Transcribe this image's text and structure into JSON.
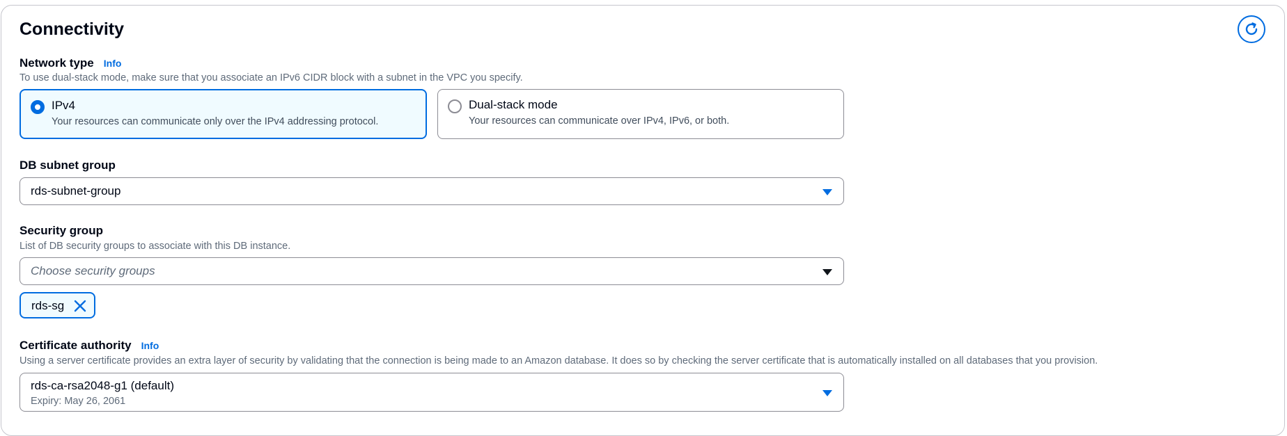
{
  "section": {
    "title": "Connectivity",
    "refresh_icon": "refresh-icon"
  },
  "network_type": {
    "label": "Network type",
    "info": "Info",
    "description": "To use dual-stack mode, make sure that you associate an IPv6 CIDR block with a subnet in the VPC you specify.",
    "options": [
      {
        "title": "IPv4",
        "description": "Your resources can communicate only over the IPv4 addressing protocol.",
        "selected": true
      },
      {
        "title": "Dual-stack mode",
        "description": "Your resources can communicate over IPv4, IPv6, or both.",
        "selected": false
      }
    ]
  },
  "db_subnet_group": {
    "label": "DB subnet group",
    "value": "rds-subnet-group"
  },
  "security_group": {
    "label": "Security group",
    "description": "List of DB security groups to associate with this DB instance.",
    "placeholder": "Choose security groups",
    "tokens": [
      "rds-sg"
    ]
  },
  "certificate_authority": {
    "label": "Certificate authority",
    "info": "Info",
    "description": "Using a server certificate provides an extra layer of security by validating that the connection is being made to an Amazon database. It does so by checking the server certificate that is automatically installed on all databases that you provision.",
    "value": "rds-ca-rsa2048-g1 (default)",
    "expiry": "Expiry: May 26, 2061"
  },
  "colors": {
    "accent": "#006ce0",
    "text": "#000716",
    "muted": "#5f6b7a",
    "border": "#8c8c94",
    "selected_bg": "#f0fbff"
  }
}
